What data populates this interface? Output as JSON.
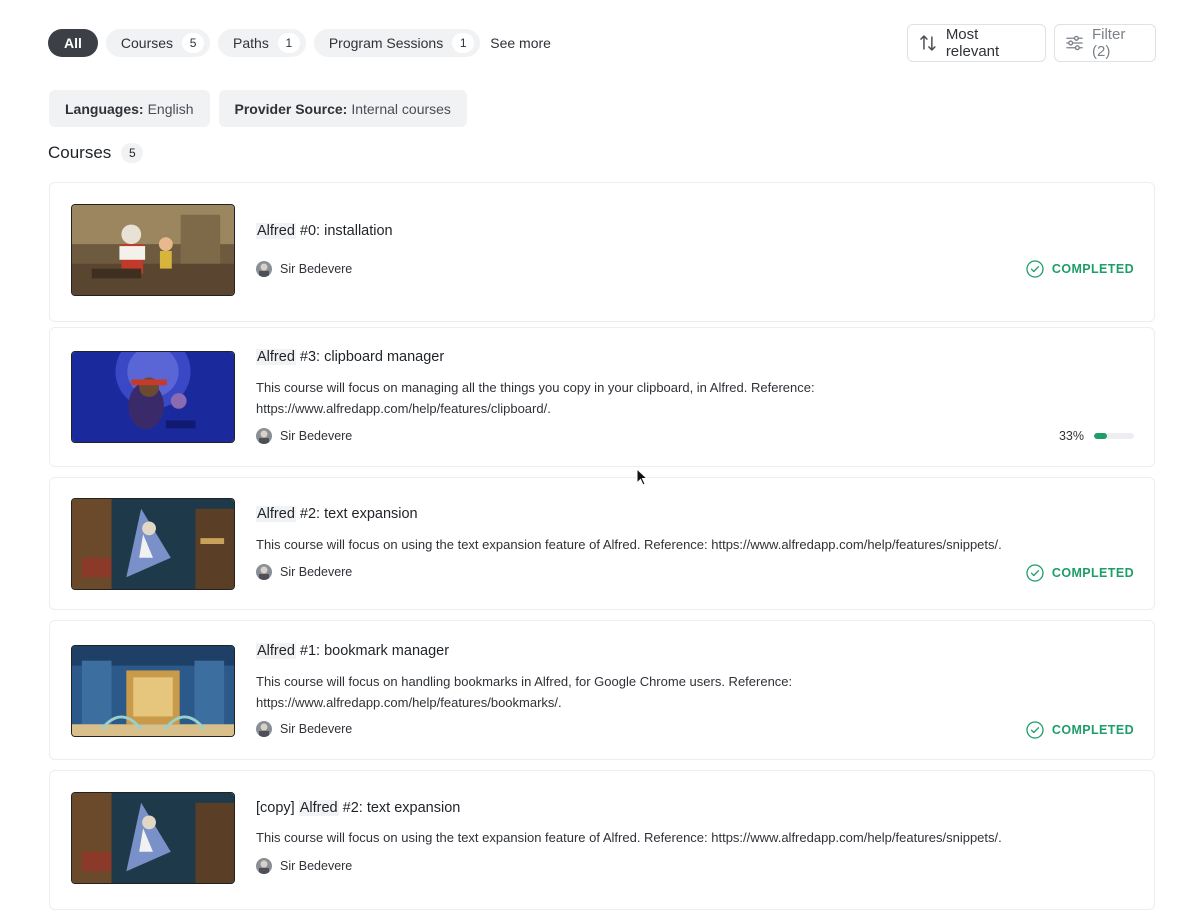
{
  "tabs": [
    {
      "label": "All",
      "count": null,
      "active": true
    },
    {
      "label": "Courses",
      "count": "5"
    },
    {
      "label": "Paths",
      "count": "1"
    },
    {
      "label": "Program Sessions",
      "count": "1"
    }
  ],
  "see_more": "See more",
  "sort": {
    "label": "Most relevant",
    "icon": "sort-arrows-icon"
  },
  "filter": {
    "label": "Filter (2)",
    "icon": "sliders-icon"
  },
  "chips": [
    {
      "key": "Languages:",
      "value": "English"
    },
    {
      "key": "Provider Source:",
      "value": "Internal courses"
    }
  ],
  "section": {
    "title": "Courses",
    "count": "5"
  },
  "courses": [
    {
      "prefix": "",
      "highlight": "Alfred",
      "title_rest": " #0: installation",
      "description": "",
      "author": "Sir Bedevere",
      "status": "COMPLETED"
    },
    {
      "prefix": "",
      "highlight": "Alfred",
      "title_rest": " #3: clipboard manager",
      "description": "This course will focus on managing all the things you copy in your clipboard, in Alfred. Reference: https://www.alfredapp.com/help/features/clipboard/.",
      "author": "Sir Bedevere",
      "progress_label": "33%",
      "progress": 0.33
    },
    {
      "prefix": "",
      "highlight": "Alfred",
      "title_rest": " #2: text expansion",
      "description": "This course will focus on using the text expansion feature of Alfred. Reference: https://www.alfredapp.com/help/features/snippets/.",
      "author": "Sir Bedevere",
      "status": "COMPLETED"
    },
    {
      "prefix": "",
      "highlight": "Alfred",
      "title_rest": " #1: bookmark manager",
      "description": "This course will focus on handling bookmarks in Alfred, for Google Chrome users. Reference: https://www.alfredapp.com/help/features/bookmarks/.",
      "author": "Sir Bedevere",
      "status": "COMPLETED"
    },
    {
      "prefix": "[copy] ",
      "highlight": "Alfred",
      "title_rest": " #2: text expansion",
      "description": "This course will focus on using the text expansion feature of Alfred. Reference: https://www.alfredapp.com/help/features/snippets/.",
      "author": "Sir Bedevere"
    }
  ],
  "colors": {
    "accent": "#1f9d69",
    "active_tab": "#3c4046",
    "chip_bg": "#f1f2f4"
  }
}
